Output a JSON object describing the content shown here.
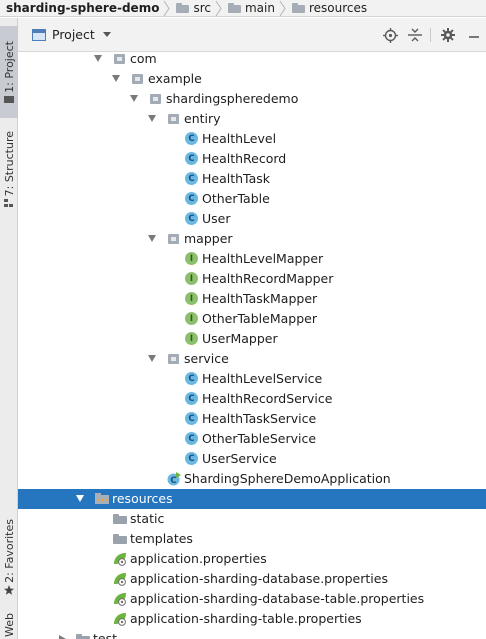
{
  "breadcrumb": {
    "items": [
      "sharding-sphere-demo",
      "src",
      "main",
      "resources"
    ]
  },
  "side_strip": {
    "project_tab": "1: Project",
    "structure_tab": "7: Structure",
    "favorites_tab": "2: Favorites",
    "web_tab": "Web"
  },
  "project_panel": {
    "view_label": "Project"
  },
  "tree": {
    "com": "com",
    "example": "example",
    "pkg": "shardingspheredemo",
    "entity": "entiry",
    "entity_classes": [
      "HealthLevel",
      "HealthRecord",
      "HealthTask",
      "OtherTable",
      "User"
    ],
    "mapper": "mapper",
    "mapper_interfaces": [
      "HealthLevelMapper",
      "HealthRecordMapper",
      "HealthTaskMapper",
      "OtherTableMapper",
      "UserMapper"
    ],
    "service": "service",
    "service_classes": [
      "HealthLevelService",
      "HealthRecordService",
      "HealthTaskService",
      "OtherTableService",
      "UserService"
    ],
    "app_class": "ShardingSphereDemoApplication",
    "resources": "resources",
    "static": "static",
    "templates": "templates",
    "properties": [
      "application.properties",
      "application-sharding-database.properties",
      "application-sharding-database-table.properties",
      "application-sharding-table.properties"
    ],
    "test": "test"
  },
  "colors": {
    "selection": "#2675bf",
    "class_badge": "#69b8e2",
    "interface_badge": "#8cc06d",
    "spring_leaf": "#6db33f"
  }
}
